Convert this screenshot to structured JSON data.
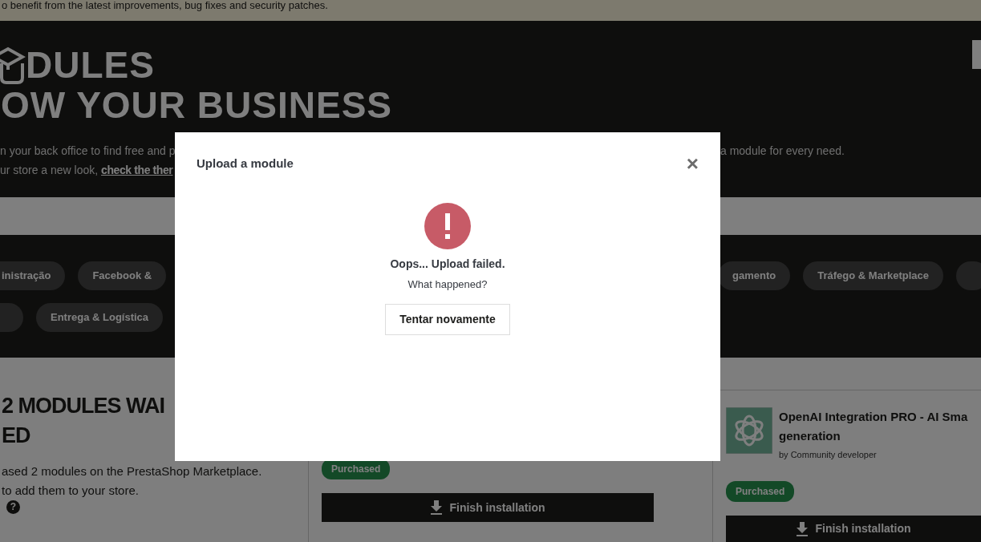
{
  "notice": {
    "text": "o benefit from the latest improvements, bug fixes and security patches."
  },
  "hero": {
    "title_lines": [
      "DULES",
      "OW YOUR BUSINESS"
    ],
    "description": [
      {
        "left": "n your back office to find free and p",
        "right": "a module for every need."
      },
      {
        "left": "ur store a new look, ",
        "link": "check the ther"
      }
    ]
  },
  "categories": [
    [
      {
        "kind": "pill",
        "label": "inistração"
      },
      {
        "kind": "pill",
        "label": "Facebook &"
      },
      {
        "kind": "gap"
      },
      {
        "kind": "pill",
        "label": "gamento"
      },
      {
        "kind": "pill",
        "label": "Tráfego & Marketplace"
      },
      {
        "kind": "cut"
      }
    ],
    [
      {
        "kind": "cut"
      },
      {
        "kind": "pill",
        "label": "Entrega & Logística"
      }
    ]
  ],
  "purchases": {
    "heading_lines": [
      "2 MODULES WAI",
      "ED"
    ],
    "text_lines": [
      "ased 2 modules on the PrestaShop Marketplace.",
      " to add them to your store."
    ],
    "help_mark": "?"
  },
  "modules": [
    {
      "badge": "Purchased",
      "action": "Finish installation"
    },
    {
      "title_lines": [
        "OpenAI Integration PRO - AI Sma",
        "generation"
      ],
      "author": "by Community developer",
      "badge": "Purchased",
      "action": "Finish installation"
    }
  ],
  "modal": {
    "title": "Upload a module",
    "close": "×",
    "kind": "error",
    "message": "Oops... Upload failed.",
    "detail": "What happened?",
    "button": "Tentar novamente"
  }
}
